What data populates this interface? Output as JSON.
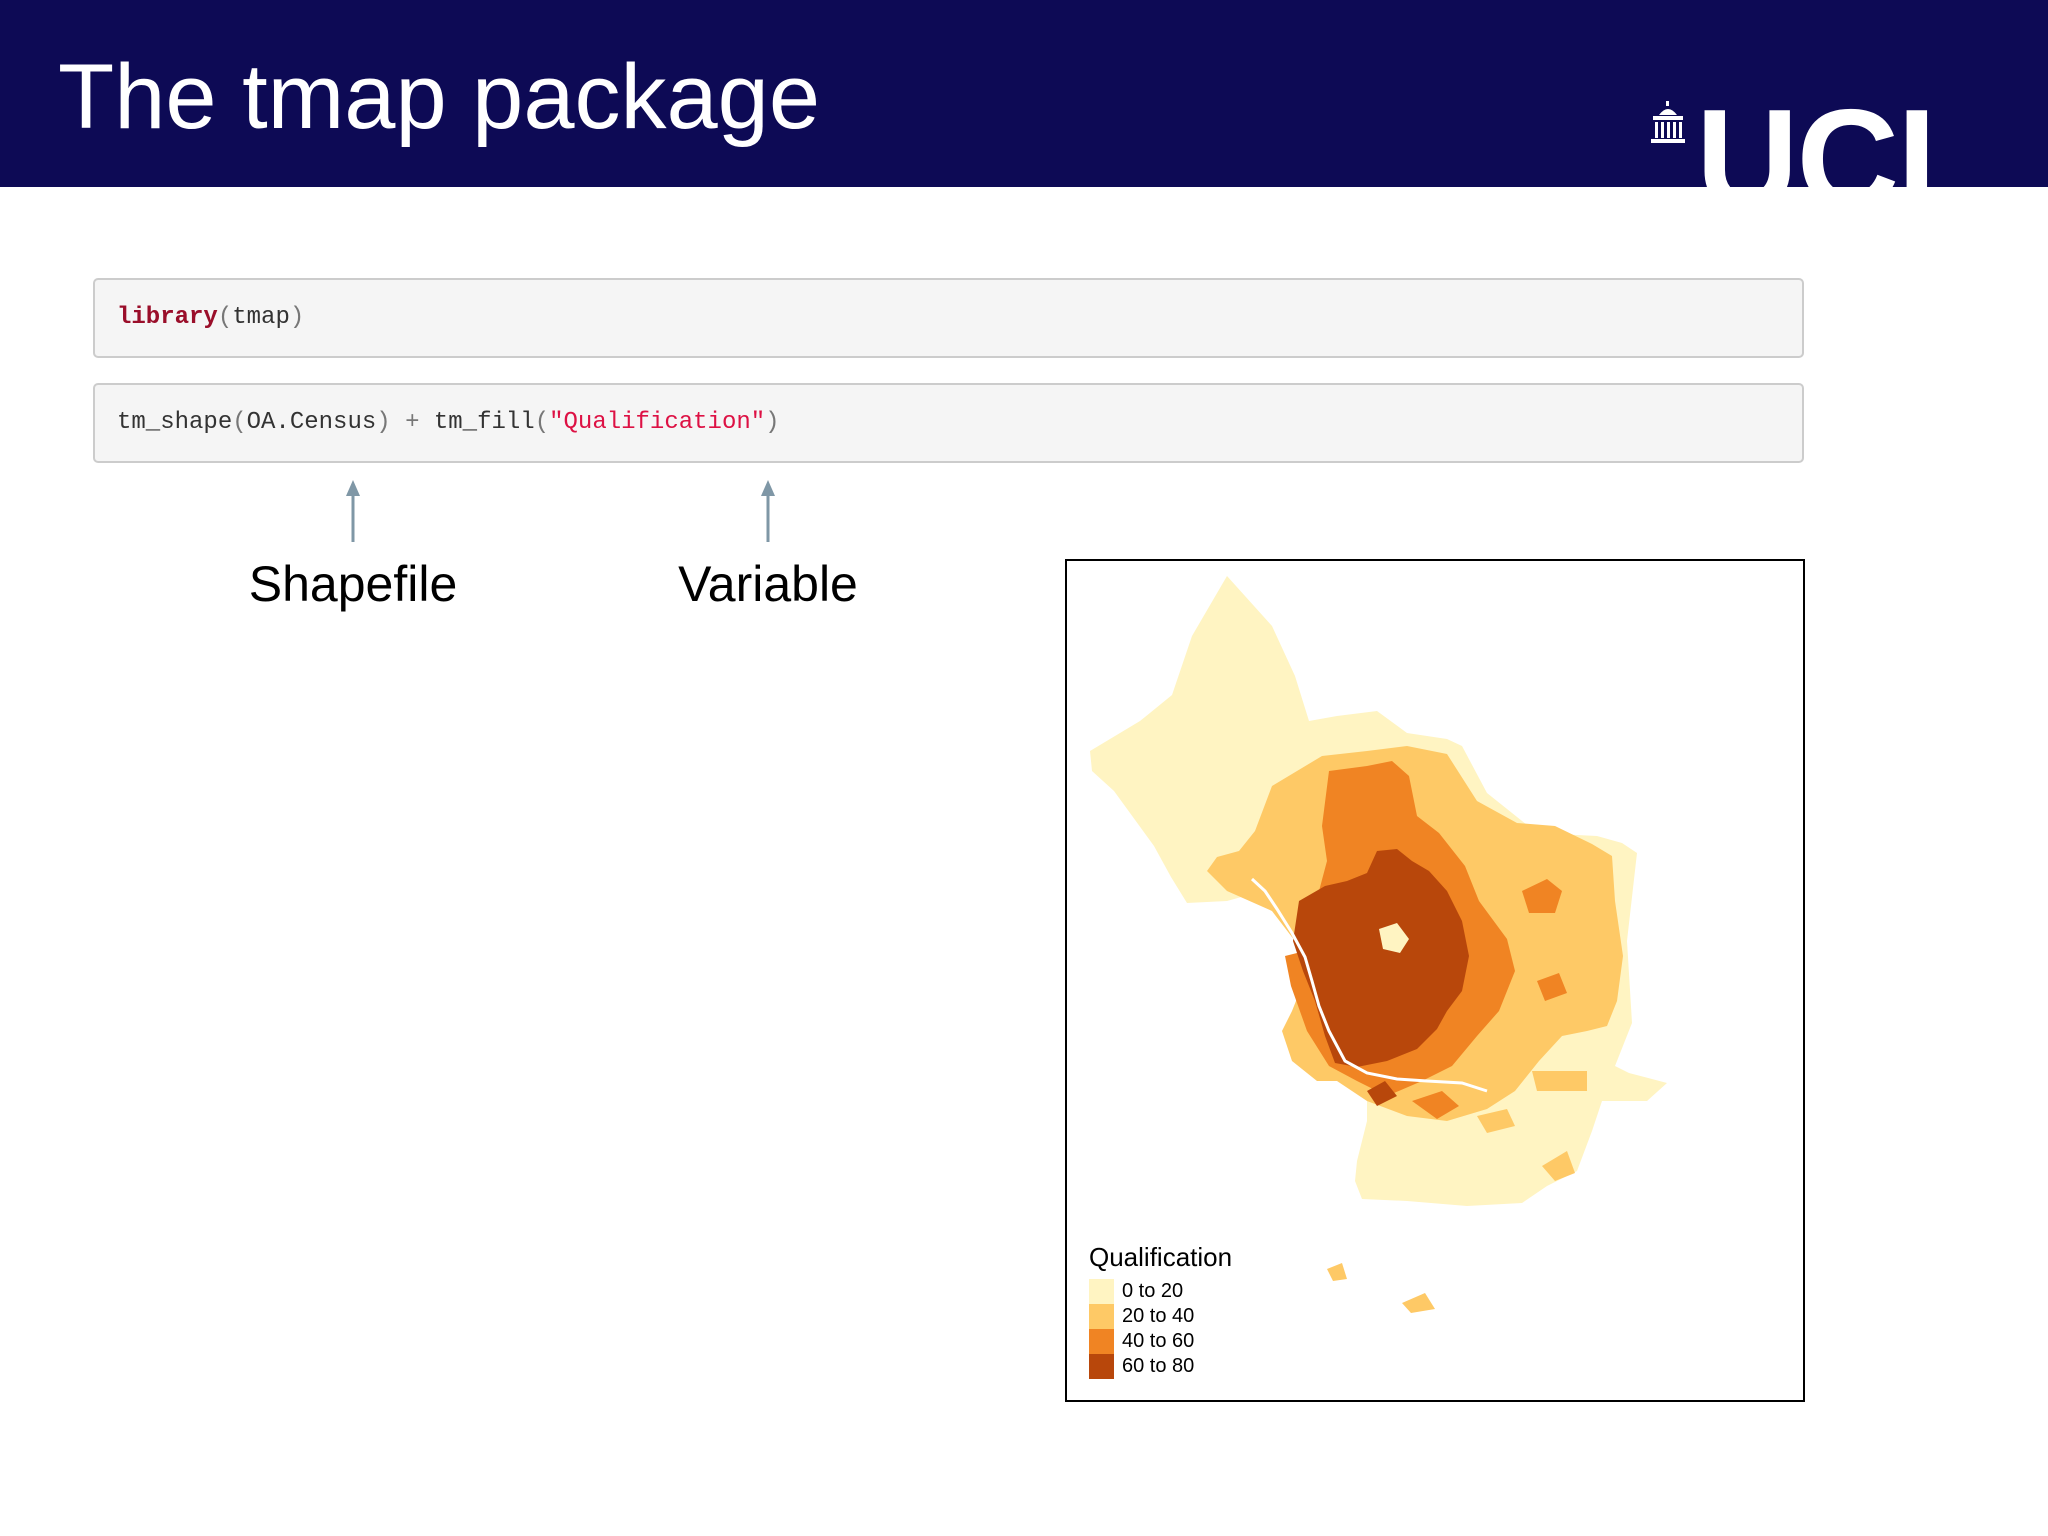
{
  "header": {
    "title": "The tmap package",
    "logo_text": "UCL"
  },
  "code": {
    "line1": {
      "func": "library",
      "arg": "tmap"
    },
    "line2": {
      "func1": "tm_shape",
      "arg1": "OA.Census",
      "op": "+",
      "func2": "tm_fill",
      "arg2": "\"Qualification\""
    }
  },
  "annotations": {
    "shapefile_label": "Shapefile",
    "variable_label": "Variable"
  },
  "map": {
    "legend": {
      "title": "Qualification",
      "items": [
        {
          "label": "0 to 20",
          "color": "#fff4c2"
        },
        {
          "label": "20 to 40",
          "color": "#fec966"
        },
        {
          "label": "40 to 60",
          "color": "#f08423"
        },
        {
          "label": "60 to 80",
          "color": "#b8470b"
        }
      ]
    }
  },
  "colors": {
    "header_bg": "#0d0a55",
    "arrow": "#7f97a6"
  }
}
